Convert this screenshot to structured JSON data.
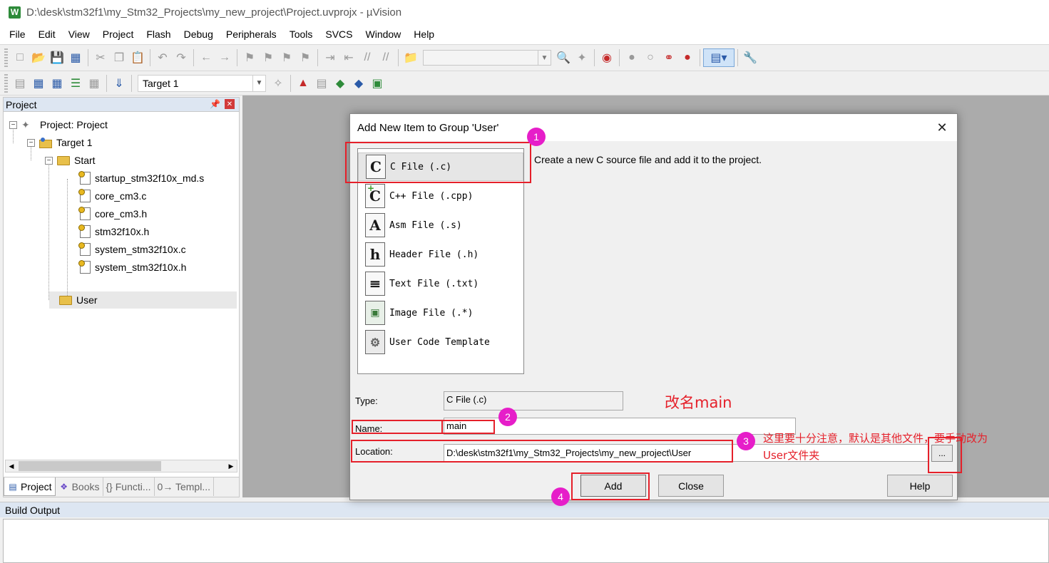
{
  "window": {
    "title": "D:\\desk\\stm32f1\\my_Stm32_Projects\\my_new_project\\Project.uvprojx - µVision",
    "logo_letter": "W"
  },
  "menu": [
    "File",
    "Edit",
    "View",
    "Project",
    "Flash",
    "Debug",
    "Peripherals",
    "Tools",
    "SVCS",
    "Window",
    "Help"
  ],
  "toolbar": {
    "target_select": "Target 1"
  },
  "project_panel": {
    "title": "Project",
    "pin_icon": "pin-icon",
    "tree": {
      "root": "Project: Project",
      "target": "Target 1",
      "group_start": "Start",
      "files": [
        "startup_stm32f10x_md.s",
        "core_cm3.c",
        "core_cm3.h",
        "stm32f10x.h",
        "system_stm32f10x.c",
        "system_stm32f10x.h"
      ],
      "group_user": "User"
    },
    "tabs": [
      "Project",
      "Books",
      "{} Functi...",
      "0→ Templ..."
    ]
  },
  "build_output": {
    "title": "Build Output"
  },
  "dialog": {
    "title": "Add New Item to Group 'User'",
    "items": [
      {
        "label": "C File (.c)",
        "icon_text": "C",
        "icon": "c-file-icon"
      },
      {
        "label": "C++ File (.cpp)",
        "icon_text": "C",
        "icon": "cpp-file-icon"
      },
      {
        "label": "Asm File (.s)",
        "icon_text": "A",
        "icon": "asm-file-icon"
      },
      {
        "label": "Header File (.h)",
        "icon_text": "h",
        "icon": "header-file-icon"
      },
      {
        "label": "Text File (.txt)",
        "icon_text": "≡",
        "icon": "text-file-icon"
      },
      {
        "label": "Image File (.*)",
        "icon_text": "▣",
        "icon": "image-file-icon"
      },
      {
        "label": "User Code Template",
        "icon_text": "⚙",
        "icon": "template-icon"
      }
    ],
    "selected_index": 0,
    "description": "Create a new C source file and add it to the project.",
    "type_label": "Type:",
    "type_value": "C File (.c)",
    "name_label": "Name:",
    "name_value": "main",
    "location_label": "Location:",
    "location_value": "D:\\desk\\stm32f1\\my_Stm32_Projects\\my_new_project\\User",
    "browse_label": "...",
    "add_label": "Add",
    "close_label": "Close",
    "help_label": "Help"
  },
  "annotations": {
    "step1": "1",
    "step2": "2",
    "step3": "3",
    "step4": "4",
    "rename_note": "改名main",
    "location_note_line1": "这里要十分注意，默认是其他文件，要手动改为",
    "location_note_line2": "User文件夹",
    "color": "#e5202a",
    "badge_color": "#e61ec9"
  }
}
